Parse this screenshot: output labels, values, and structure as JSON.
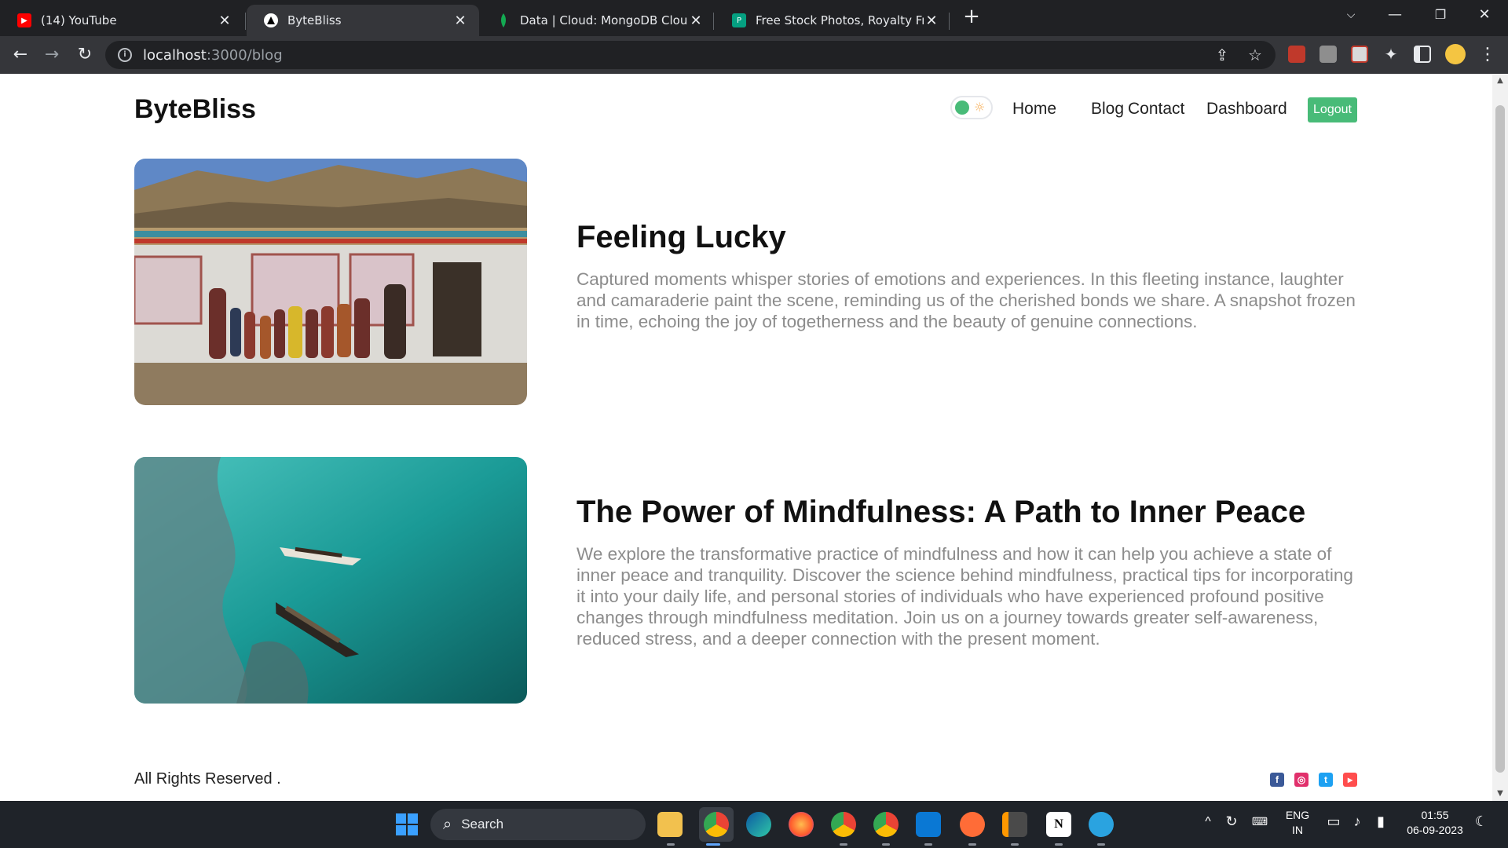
{
  "browser": {
    "tabs": [
      {
        "title": "(14) YouTube",
        "icon": "youtube-icon",
        "active": false
      },
      {
        "title": "ByteBliss",
        "icon": "vercel-triangle-icon",
        "active": true
      },
      {
        "title": "Data | Cloud: MongoDB Cloud",
        "icon": "mongodb-leaf-icon",
        "active": false
      },
      {
        "title": "Free Stock Photos, Royalty Free S",
        "icon": "pexels-icon",
        "active": false
      }
    ],
    "url_host": "localhost",
    "url_path": ":3000/blog"
  },
  "site": {
    "brand": "ByteBliss",
    "nav": [
      "Home",
      "Blog",
      "Contact",
      "Dashboard"
    ],
    "logout_label": "Logout",
    "theme_toggle_icon": "sun-icon"
  },
  "posts": [
    {
      "title": "Feeling Lucky",
      "excerpt": "Captured moments whisper stories of emotions and experiences. In this fleeting instance, laughter and camaraderie paint the scene, reminding us of the cherished bonds we share. A snapshot frozen in time, echoing the joy of togetherness and the beauty of genuine connections.",
      "image": "group-photo-mountain-village"
    },
    {
      "title": "The Power of Mindfulness: A Path to Inner Peace",
      "excerpt": "We explore the transformative practice of mindfulness and how it can help you achieve a state of inner peace and tranquility. Discover the science behind mindfulness, practical tips for incorporating it into your daily life, and personal stories of individuals who have experienced profound positive changes through mindfulness meditation. Join us on a journey towards greater self-awareness, reduced stress, and a deeper connection with the present moment.",
      "image": "aerial-boats-turquoise-sea"
    }
  ],
  "footer": {
    "text": "All Rights Reserved .",
    "social": [
      "facebook-icon",
      "instagram-icon",
      "twitter-icon",
      "youtube-icon"
    ]
  },
  "taskbar": {
    "search_label": "Search",
    "lang_top": "ENG",
    "lang_bottom": "IN",
    "time": "01:55",
    "date": "06-09-2023"
  },
  "colors": {
    "accent": "#48bb78",
    "chrome_dark": "#202124",
    "chrome_mid": "#35363a",
    "excerpt_gray": "#8c8c8c"
  }
}
